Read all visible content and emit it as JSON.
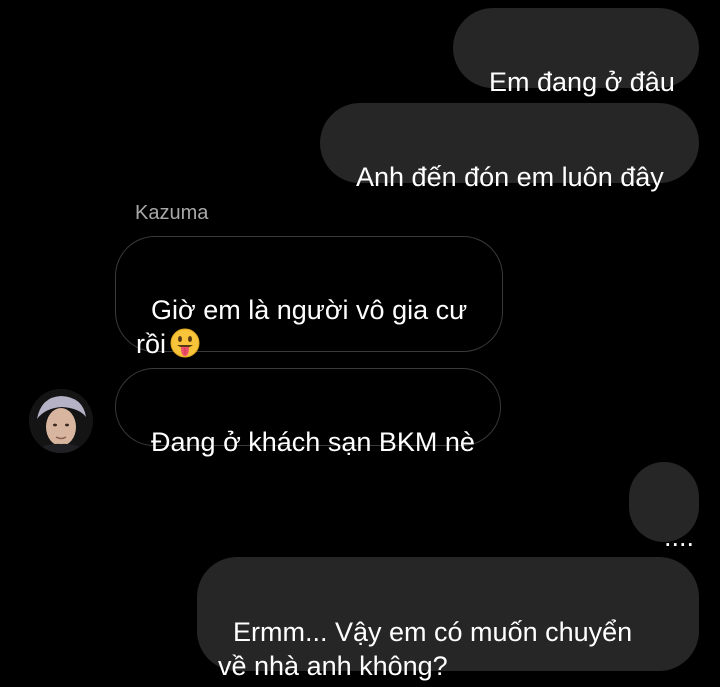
{
  "thread": {
    "sender_name": "Kazuma",
    "messages": [
      {
        "direction": "outgoing",
        "text": "Em đang ở đâu"
      },
      {
        "direction": "outgoing",
        "text": "Anh đến đón em luôn đây"
      },
      {
        "direction": "incoming",
        "text": "Giờ em là người vô gia cư\nrồi",
        "emoji": "tongue-out-face"
      },
      {
        "direction": "incoming",
        "text": "Đang ở khách sạn BKM nè"
      },
      {
        "direction": "outgoing",
        "text": "...."
      },
      {
        "direction": "outgoing",
        "text": "Ermm... Vậy em có muốn chuyển\nvề nhà anh không?"
      }
    ]
  },
  "colors": {
    "background": "#000000",
    "outgoing_bubble": "#262626",
    "incoming_border": "#3a3a3a",
    "text": "#ffffff",
    "sender_name": "#a8a8a8"
  }
}
